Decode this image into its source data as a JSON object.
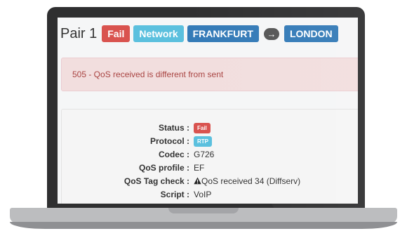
{
  "pair": {
    "title": "Pair 1",
    "status_badge": "Fail",
    "type_badge": "Network",
    "from": "FRANKFURT",
    "arrow_icon": "arrow-right-icon",
    "to": "LONDON"
  },
  "alert": {
    "message": "505 - QoS received is different from sent"
  },
  "details": {
    "status": {
      "label": "Status :",
      "value": "Fail"
    },
    "protocol": {
      "label": "Protocol :",
      "value": "RTP"
    },
    "codec": {
      "label": "Codec :",
      "value": "G726"
    },
    "qos_profile": {
      "label": "QoS profile :",
      "value": "EF"
    },
    "qos_tag_check": {
      "label": "QoS Tag check :",
      "value": "QoS received 34 (Diffserv)",
      "icon": "warning-icon"
    },
    "script": {
      "label": "Script :",
      "value": "VoIP"
    }
  },
  "colors": {
    "fail": "#d9534f",
    "info": "#5bc0de",
    "primary": "#337ab7",
    "alert_bg": "#f2dede",
    "alert_text": "#a94442"
  }
}
